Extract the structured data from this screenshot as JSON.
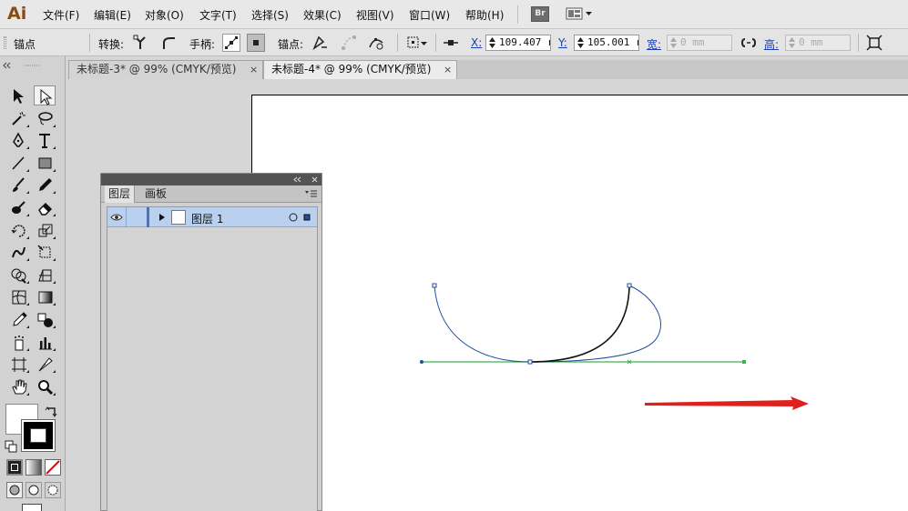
{
  "app": {
    "logo": "Ai"
  },
  "menubar": {
    "items": [
      "文件(F)",
      "编辑(E)",
      "对象(O)",
      "文字(T)",
      "选择(S)",
      "效果(C)",
      "视图(V)",
      "窗口(W)",
      "帮助(H)"
    ],
    "bridge_button": "Br"
  },
  "controlbar": {
    "tool_name": "锚点",
    "convert_label": "转换:",
    "handles_label": "手柄:",
    "anchor_label": "锚点:",
    "x_label": "X:",
    "x_value": "109.407 r",
    "y_label": "Y:",
    "y_value": "105.001 r",
    "w_label": "宽:",
    "w_value": "0 mm",
    "h_label": "高:",
    "h_value": "0 mm"
  },
  "tabs": [
    {
      "label": "未标题-3* @ 99% (CMYK/预览)",
      "close": "×",
      "active": false
    },
    {
      "label": "未标题-4* @ 99% (CMYK/预览)",
      "close": "×",
      "active": true
    }
  ],
  "tools": [
    "selection-tool",
    "direct-selection-tool",
    "magic-wand-tool",
    "lasso-tool",
    "pen-tool",
    "type-tool",
    "line-segment-tool",
    "rectangle-tool",
    "paintbrush-tool",
    "pencil-tool",
    "blob-brush-tool",
    "eraser-tool",
    "rotate-tool",
    "scale-tool",
    "warp-tool",
    "free-transform-tool",
    "shape-builder-tool",
    "perspective-grid-tool",
    "mesh-tool",
    "gradient-tool",
    "eyedropper-tool",
    "blend-tool",
    "symbol-sprayer-tool",
    "column-graph-tool",
    "artboard-tool",
    "slice-tool",
    "hand-tool",
    "zoom-tool"
  ],
  "layers_panel": {
    "tabs": [
      "图层",
      "画板"
    ],
    "layer_name": "图层 1"
  },
  "colors": {
    "path_selected": "#1f4f9a",
    "path_black": "#111111",
    "handle_line": "#3fb34f",
    "arrow_red": "#e0201c",
    "layer_highlight": "#b9d0ef"
  }
}
